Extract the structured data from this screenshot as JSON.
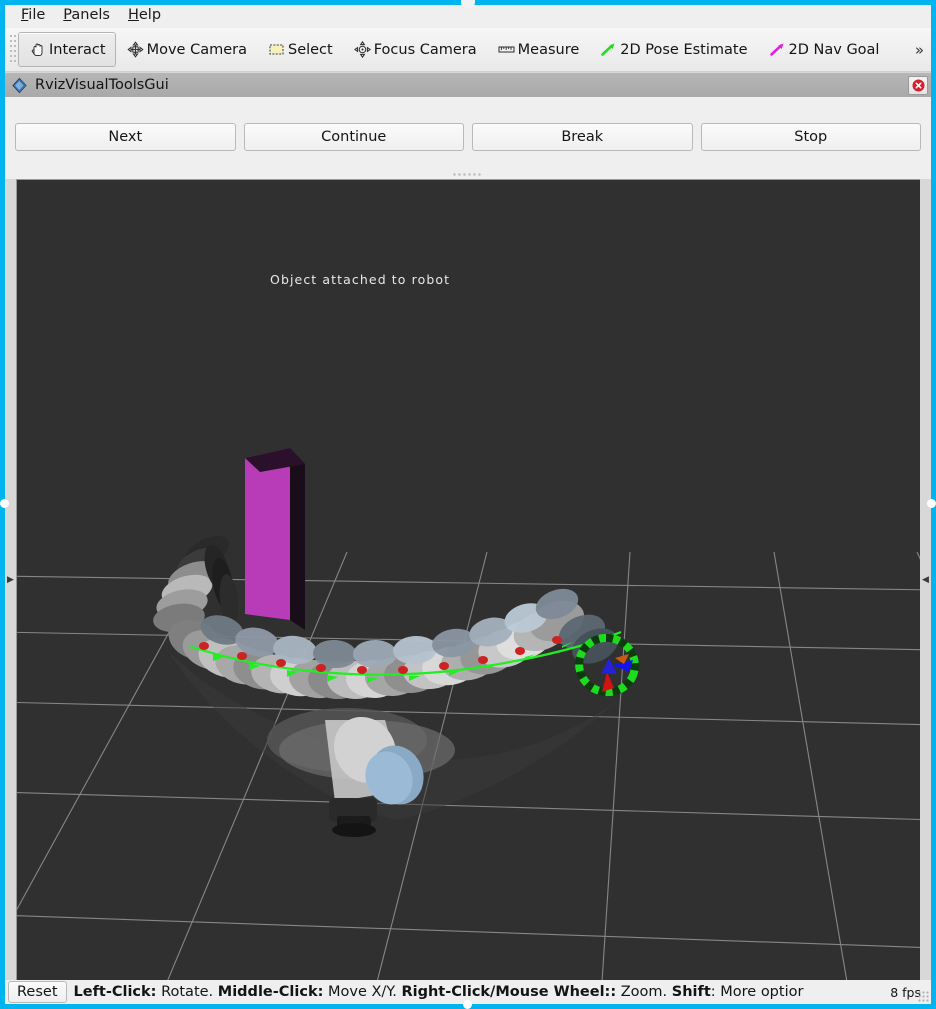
{
  "window": {
    "accent_color": "#00b4f0",
    "chrome_bg": "#efefef"
  },
  "menubar": {
    "items": [
      {
        "label": "File",
        "mnemonic": "F"
      },
      {
        "label": "Panels",
        "mnemonic": "P"
      },
      {
        "label": "Help",
        "mnemonic": "H"
      }
    ]
  },
  "toolbar": {
    "tools": [
      {
        "label": "Interact",
        "icon": "hand-cursor-icon",
        "checked": true
      },
      {
        "label": "Move Camera",
        "icon": "move-camera-icon",
        "checked": false
      },
      {
        "label": "Select",
        "icon": "select-rect-icon",
        "checked": false
      },
      {
        "label": "Focus Camera",
        "icon": "focus-camera-icon",
        "checked": false
      },
      {
        "label": "Measure",
        "icon": "ruler-icon",
        "checked": false
      },
      {
        "label": "2D Pose Estimate",
        "icon": "green-arrow-icon",
        "checked": false,
        "color": "#22dd22"
      },
      {
        "label": "2D Nav Goal",
        "icon": "magenta-arrow-icon",
        "checked": false,
        "color": "#e21ee2"
      }
    ],
    "overflow_label": "»"
  },
  "panel": {
    "title": "RvizVisualToolsGui",
    "icon": "rviz-diamond-icon",
    "close_icon": "close-icon",
    "buttons": [
      {
        "label": "Next"
      },
      {
        "label": "Continue"
      },
      {
        "label": "Break"
      },
      {
        "label": "Stop"
      }
    ]
  },
  "viewport": {
    "background_color": "#303030",
    "grid_color": "#9a9a9a",
    "scene_label": "Object  attached  to  robot",
    "object_color": "#b83bb8",
    "trajectory_color": "#22ee22",
    "marker_color": "#cc2222",
    "splitter_left_arrow": "▶",
    "splitter_right_arrow": "◀"
  },
  "statusbar": {
    "reset_label": "Reset",
    "hint_segments": [
      {
        "text": "Left-Click:",
        "bold": true
      },
      {
        "text": " Rotate. ",
        "bold": false
      },
      {
        "text": "Middle-Click:",
        "bold": true
      },
      {
        "text": " Move X/Y. ",
        "bold": false
      },
      {
        "text": "Right-Click/Mouse Wheel::",
        "bold": true
      },
      {
        "text": " Zoom. ",
        "bold": false
      },
      {
        "text": "Shift",
        "bold": true
      },
      {
        "text": ": More optior",
        "bold": false
      }
    ],
    "fps": "8 fps"
  }
}
